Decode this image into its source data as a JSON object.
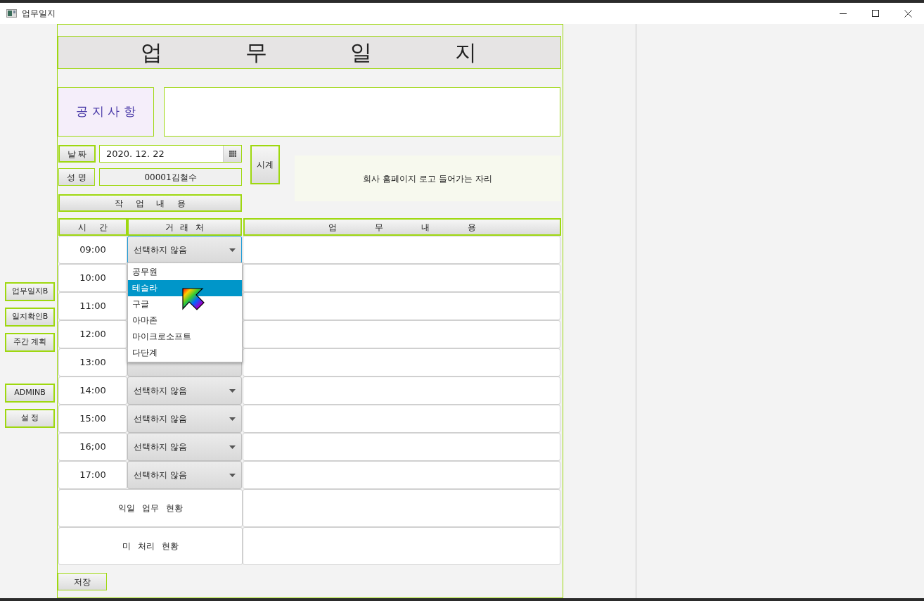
{
  "window": {
    "title": "업무일지"
  },
  "sidebar": {
    "buttons": [
      {
        "label": "업무일지B"
      },
      {
        "label": "일지확인B"
      },
      {
        "label": "주간 계획"
      },
      {
        "label": "ADMINB"
      },
      {
        "label": "설 정"
      }
    ]
  },
  "heading": "업무일지",
  "notice": {
    "label": "공 지 사 항"
  },
  "date": {
    "label": "날 짜",
    "value": "2020. 12. 22"
  },
  "name": {
    "label": "성 명",
    "value": "00001김철수"
  },
  "clock_button": "시계",
  "logo_placeholder": "회사 홈페이지 로고 들어가는 자리",
  "work_button": "작 업 내 용",
  "table": {
    "columns": [
      "시 간",
      "거 래 처",
      "업 무 내 용"
    ],
    "rows": [
      {
        "time": "09:00",
        "client": "선택하지 않음",
        "focused": true
      },
      {
        "time": "10:00"
      },
      {
        "time": "11:00"
      },
      {
        "time": "12:00"
      },
      {
        "time": "13:00",
        "focused": false
      },
      {
        "time": "14:00",
        "client": "선택하지 않음",
        "focused": false
      },
      {
        "time": "15:00",
        "client": "선택하지 않음",
        "focused": false
      },
      {
        "time": "16;00",
        "client": "선택하지 않음",
        "focused": false
      },
      {
        "time": "17:00",
        "client": "선택하지 않음",
        "focused": false
      }
    ]
  },
  "summary_rows": [
    {
      "label": "익일 업무 현황"
    },
    {
      "label": "미 처리 현황"
    }
  ],
  "dropdown": {
    "options": [
      {
        "label": "공무원",
        "selected": false
      },
      {
        "label": "테슬라",
        "selected": true
      },
      {
        "label": "구글",
        "selected": false
      },
      {
        "label": "아마존",
        "selected": false
      },
      {
        "label": "마이크로소프트",
        "selected": false
      },
      {
        "label": "다단계",
        "selected": false
      }
    ]
  },
  "save_button": "저장"
}
